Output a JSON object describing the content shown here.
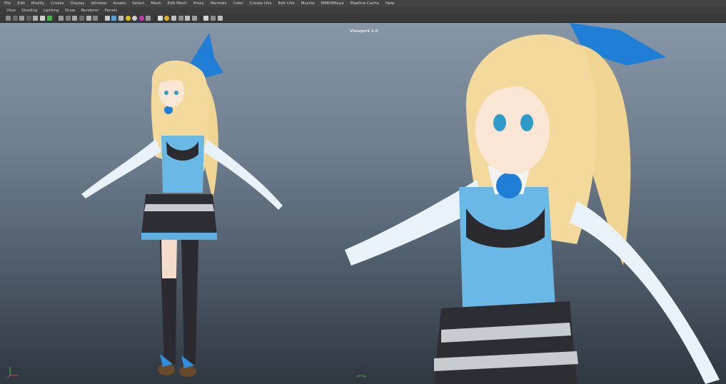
{
  "menubar": {
    "items": [
      "File",
      "Edit",
      "Modify",
      "Create",
      "Display",
      "Window",
      "Assets",
      "Select",
      "Mesh",
      "Edit Mesh",
      "Proxy",
      "Normals",
      "Color",
      "Create UVs",
      "Edit UVs",
      "Muscle",
      "MMD4Maya",
      "Pipeline Cache",
      "Help"
    ]
  },
  "panel_menu": {
    "items": [
      "View",
      "Shading",
      "Lighting",
      "Show",
      "Renderer",
      "Panels"
    ]
  },
  "toolbar": {
    "icons": [
      "select-camera-icon",
      "camera-attr-icon",
      "bookmark-icon",
      "image-plane-icon",
      "grid-icon",
      "film-gate-icon",
      "resolution-gate-icon",
      "wireframe-icon",
      "smooth-shade-icon",
      "textured-icon",
      "lights-icon",
      "shadows-icon",
      "isolate-icon",
      "xray-icon"
    ]
  },
  "viewport": {
    "title": "Viewport 2.0",
    "camera_label": "persp"
  },
  "colors": {
    "menubar_bg": "#444444",
    "viewport_top": "#8696a6",
    "viewport_bottom": "#2f3740",
    "hair": "#f3d99b",
    "outfit_blue": "#6ab8e6",
    "ribbon_blue": "#1f7fd6"
  }
}
